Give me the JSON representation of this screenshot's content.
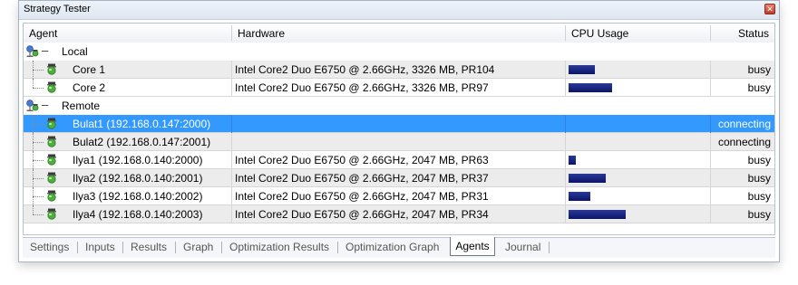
{
  "window": {
    "title": "Strategy Tester"
  },
  "columns": {
    "agent": "Agent",
    "hardware": "Hardware",
    "cpu": "CPU Usage",
    "status": "Status"
  },
  "groups": {
    "local": "Local",
    "remote": "Remote"
  },
  "rows": [
    {
      "agent": "Core 1",
      "hardware": "Intel Core2 Duo  E6750 @ 2.66GHz, 3326 MB, PR104",
      "cpu": 0.21,
      "status": "busy"
    },
    {
      "agent": "Core 2",
      "hardware": "Intel Core2 Duo  E6750 @ 2.66GHz, 3326 MB, PR97",
      "cpu": 0.34,
      "status": "busy"
    },
    {
      "agent": "Bulat1 (192.168.0.147:2000)",
      "hardware": "",
      "cpu": 0,
      "status": "connecting"
    },
    {
      "agent": "Bulat2 (192.168.0.147:2001)",
      "hardware": "",
      "cpu": 0,
      "status": "connecting"
    },
    {
      "agent": "Ilya1 (192.168.0.140:2000)",
      "hardware": "Intel Core2 Duo  E6750 @ 2.66GHz, 2047 MB, PR63",
      "cpu": 0.06,
      "status": "busy"
    },
    {
      "agent": "Ilya2 (192.168.0.140:2001)",
      "hardware": "Intel Core2 Duo  E6750 @ 2.66GHz, 2047 MB, PR37",
      "cpu": 0.29,
      "status": "busy"
    },
    {
      "agent": "Ilya3 (192.168.0.140:2002)",
      "hardware": "Intel Core2 Duo  E6750 @ 2.66GHz, 2047 MB, PR31",
      "cpu": 0.17,
      "status": "busy"
    },
    {
      "agent": "Ilya4 (192.168.0.140:2003)",
      "hardware": "Intel Core2 Duo  E6750 @ 2.66GHz, 2047 MB, PR34",
      "cpu": 0.45,
      "status": "busy"
    }
  ],
  "tabs": [
    "Settings",
    "Inputs",
    "Results",
    "Graph",
    "Optimization Results",
    "Optimization Graph",
    "Agents",
    "Journal"
  ],
  "active_tab": "Agents",
  "colors": {
    "selection": "#3399ff",
    "cpu_bar": "#1a237e",
    "row_alt": "#ececec"
  },
  "icons": {
    "group": "network-agents-icon",
    "agent": "agent-icon",
    "close": "close-icon"
  }
}
